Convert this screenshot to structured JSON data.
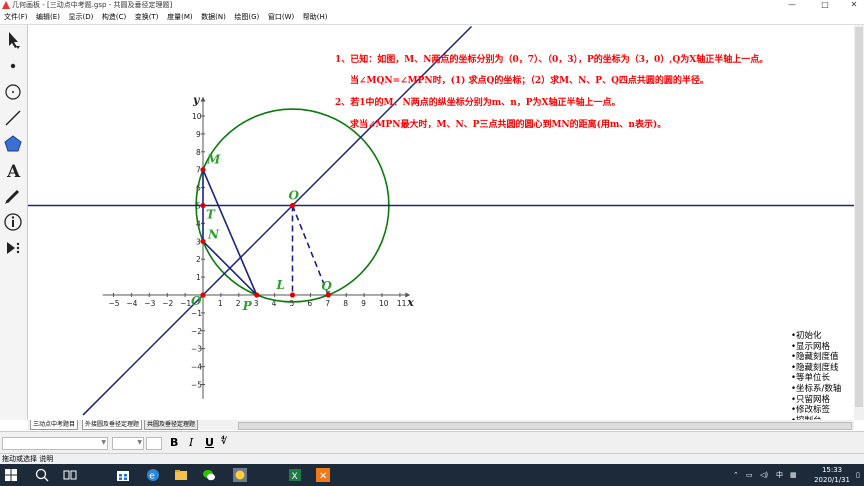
{
  "window": {
    "title": "几何画板 - [三动点中考题.gsp - 共圆及垂径定理题]",
    "controls": [
      "—",
      "□",
      "✕"
    ]
  },
  "menu": [
    "文件(F)",
    "编辑(E)",
    "显示(D)",
    "构造(C)",
    "变换(T)",
    "度量(M)",
    "数据(N)",
    "绘图(G)",
    "窗口(W)",
    "帮助(H)"
  ],
  "toolbox": [
    "select-arrow-icon",
    "point-icon",
    "compass-circle-icon",
    "line-icon",
    "polygon-icon",
    "text-icon",
    "marker-pen-icon",
    "info-icon",
    "custom-tool-icon"
  ],
  "problem": {
    "line1": "1、已知：如图，M、N两点的坐标分别为（0，7）、（0，3），P的坐标为（3，0）,Q为X轴正半轴上一点。",
    "line2": "当∠MQN=∠MPN时，(1) 求点Q的坐标；（2）求M、N、P、Q四点共圆的圆的半径。",
    "line3": "2、若1中的M、N两点的纵坐标分别为m、n，P为X轴正半轴上一点。",
    "line4": "求当∠MPN最大时，M、N、P三点共圆的圆心到MN的距离(用m、n表示)。"
  },
  "graph": {
    "x_axis_label": "x",
    "y_axis_label": "y",
    "x_ticks": [
      "−5",
      "−4",
      "−3",
      "−2",
      "−1",
      "1",
      "2",
      "3",
      "4",
      "5",
      "6",
      "7",
      "8",
      "9",
      "10",
      "11"
    ],
    "y_ticks": [
      "10",
      "9",
      "8",
      "7",
      "6",
      "5",
      "4",
      "3",
      "2",
      "1",
      "−1",
      "−2",
      "−3",
      "−4",
      "−5"
    ],
    "points": {
      "M": {
        "label": "M",
        "x": 0,
        "y": 7
      },
      "N": {
        "label": "N",
        "x": 0,
        "y": 3
      },
      "T": {
        "label": "T",
        "x": 0,
        "y": 5
      },
      "P": {
        "label": "P",
        "x": 3,
        "y": 0
      },
      "Q": {
        "label": "Q",
        "x": 7,
        "y": 0
      },
      "L": {
        "label": "L",
        "x": 5,
        "y": 0
      },
      "O1": {
        "label": "O",
        "x": 5,
        "y": 5
      },
      "O": {
        "label": "O",
        "x": 0,
        "y": 0
      }
    },
    "circle": {
      "cx": 5,
      "cy": 5,
      "r": 5.385
    },
    "colors": {
      "axes": "#555555",
      "circle": "#0a7a0a",
      "lines": "#1a237e",
      "points": "#e00000",
      "labels": "#2e9e2e",
      "problem_text": "#ff0000"
    }
  },
  "right_menu": [
    "•初始化",
    "•显示网格",
    "•隐藏刻度值",
    "•隐藏刻度线",
    "•等单位长",
    "•坐标系/数轴",
    "•只留网格",
    "•修改标签",
    "•控制台"
  ],
  "tabs": [
    "三动点中考题目",
    "外接圆及垂径定理题",
    "共圆及垂径定理题"
  ],
  "format_bar": {
    "bold": "B",
    "italic": "I",
    "underline": "U",
    "frac_symbol": "∜"
  },
  "status": "拖动或选择 说明",
  "taskbar": {
    "icons": [
      "windows-start-icon",
      "search-icon",
      "task-view-icon",
      "store-icon",
      "edge-icon",
      "explorer-icon",
      "wechat-icon",
      "sketchpad-icon",
      "excel-icon",
      "xmind-icon"
    ],
    "ime": "中",
    "time": "15:33",
    "date": "2020/1/31"
  }
}
